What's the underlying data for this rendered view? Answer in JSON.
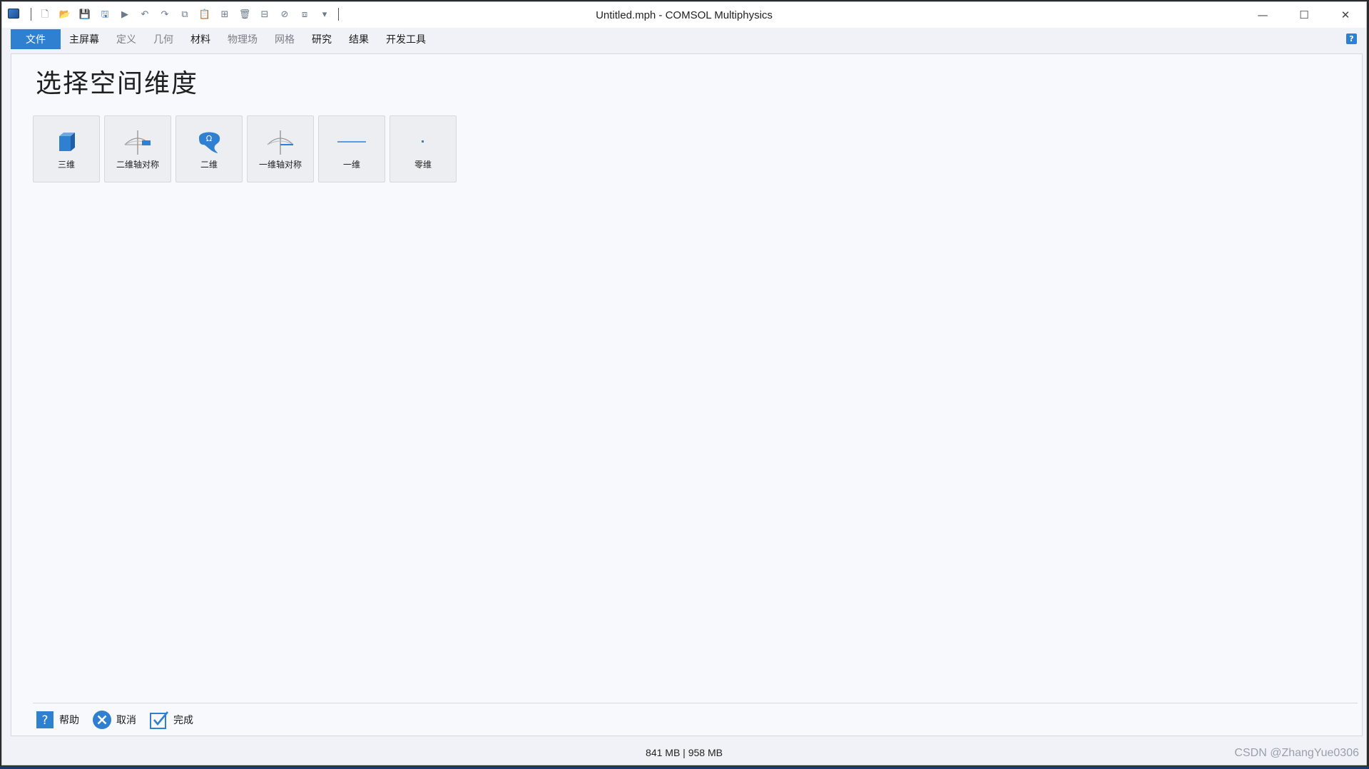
{
  "window": {
    "title": "Untitled.mph - COMSOL Multiphysics",
    "controls": [
      "—",
      "☐",
      "✕"
    ]
  },
  "ribbon": {
    "tabs": [
      {
        "label": "文件",
        "state": "active"
      },
      {
        "label": "主屏幕",
        "state": "normal"
      },
      {
        "label": "定义",
        "state": "dim"
      },
      {
        "label": "几何",
        "state": "dim"
      },
      {
        "label": "材料",
        "state": "normal"
      },
      {
        "label": "物理场",
        "state": "dim"
      },
      {
        "label": "网格",
        "state": "dim"
      },
      {
        "label": "研究",
        "state": "normal"
      },
      {
        "label": "结果",
        "state": "normal"
      },
      {
        "label": "开发工具",
        "state": "normal"
      }
    ],
    "help_label": "?"
  },
  "page": {
    "title": "选择空间维度",
    "dimensions": [
      {
        "label": "三维",
        "icon": "cube-icon"
      },
      {
        "label": "二维轴对称",
        "icon": "axisym-2d-icon"
      },
      {
        "label": "二维",
        "icon": "omega-domain-icon"
      },
      {
        "label": "一维轴对称",
        "icon": "axisym-1d-icon"
      },
      {
        "label": "一维",
        "icon": "line-icon"
      },
      {
        "label": "零维",
        "icon": "point-icon"
      }
    ]
  },
  "actions": {
    "help": "帮助",
    "cancel": "取消",
    "done": "完成"
  },
  "status": {
    "memory": "841 MB | 958 MB"
  },
  "watermark": "CSDN @ZhangYue0306",
  "colors": {
    "accent": "#2f80d1",
    "background": "#f8f9fc"
  }
}
